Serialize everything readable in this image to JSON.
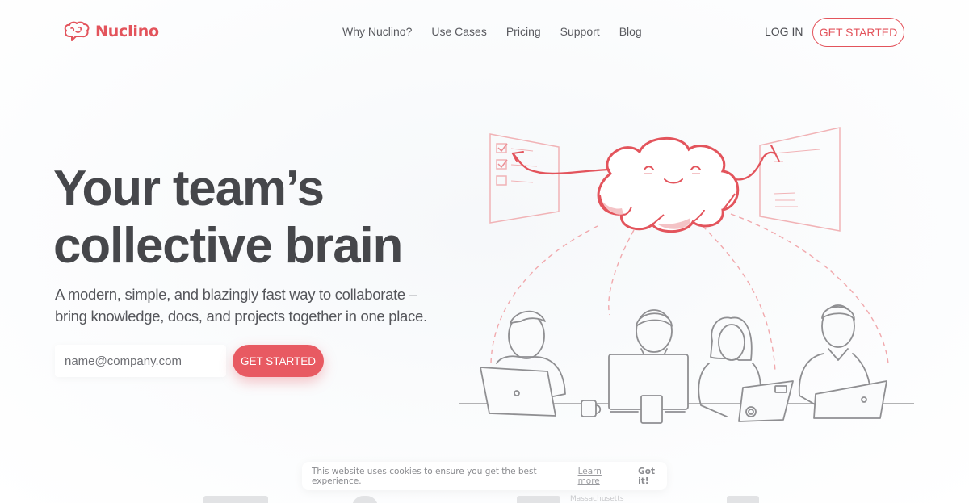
{
  "brand": {
    "name": "Nuclino",
    "logo_icon": "brain-speech-bubble-icon",
    "accent": "#e3545c"
  },
  "nav": {
    "items": [
      "Why Nuclino?",
      "Use Cases",
      "Pricing",
      "Support",
      "Blog"
    ],
    "login_label": "LOG IN",
    "cta_label": "GET STARTED"
  },
  "hero": {
    "title_lines": [
      "Your team’s",
      "collective brain"
    ],
    "subtitle_lines": [
      "A modern, simple, and blazingly fast way to collaborate –",
      "bring knowledge, docs, and projects together in one place."
    ],
    "email_placeholder": "name@company.com",
    "email_value": "",
    "cta_label": "GET STARTED"
  },
  "illustration": {
    "description": "cloud-brain connected to four team members at desks and two documents",
    "elements": [
      "smiling-cloud",
      "checklist-document",
      "notes-document",
      "person-laptop",
      "person-desktop",
      "person-laptop-sticker",
      "person-laptop-sweater",
      "coffee-mug"
    ]
  },
  "cookie_banner": {
    "message": "This website uses cookies to ensure you get the best experience.",
    "learn_more": "Learn more",
    "dismiss": "Got it!"
  },
  "customer_logos": {
    "partial_text": "Massachusetts"
  }
}
